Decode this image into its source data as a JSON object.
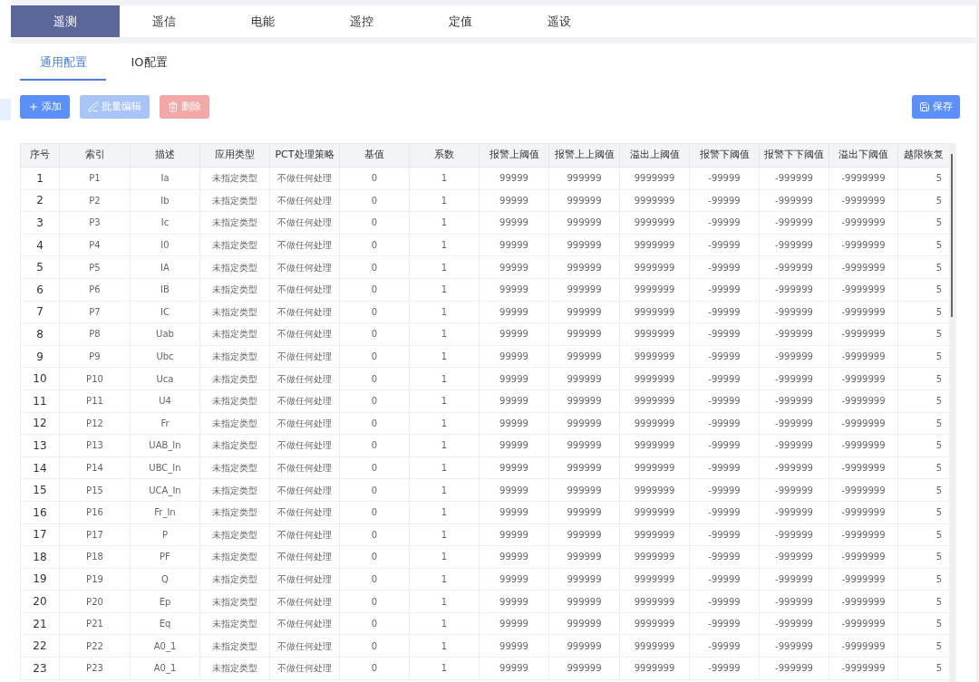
{
  "tabs": [
    {
      "label": "遥测",
      "selected": true
    },
    {
      "label": "遥信",
      "selected": false
    },
    {
      "label": "电能",
      "selected": false
    },
    {
      "label": "遥控",
      "selected": false
    },
    {
      "label": "定值",
      "selected": false
    },
    {
      "label": "遥设",
      "selected": false
    }
  ],
  "sub_tabs": [
    {
      "label": "通用配置",
      "selected": true
    },
    {
      "label": "IO配置",
      "selected": false
    }
  ],
  "toolbar": [
    {
      "kind": "add",
      "label": "添加",
      "disabled": false
    },
    {
      "kind": "edit",
      "label": "批量编辑",
      "disabled": true
    },
    {
      "kind": "delete",
      "label": "删除",
      "disabled": true
    }
  ],
  "save_button": {
    "label": "保存"
  },
  "table": {
    "columns": [
      "序号",
      "索引",
      "描述",
      "应用类型",
      "PCT处理策略",
      "基值",
      "系数",
      "报警上阈值",
      "报警上上阈值",
      "溢出上阈值",
      "报警下阈值",
      "报警下下阈值",
      "溢出下阈值",
      "越限恢复"
    ],
    "rows": [
      [
        "1",
        "P1",
        "Ia",
        "未指定类型",
        "不做任何处理",
        "0",
        "1",
        "99999",
        "999999",
        "9999999",
        "-99999",
        "-999999",
        "-9999999",
        "5"
      ],
      [
        "2",
        "P2",
        "Ib",
        "未指定类型",
        "不做任何处理",
        "0",
        "1",
        "99999",
        "999999",
        "9999999",
        "-99999",
        "-999999",
        "-9999999",
        "5"
      ],
      [
        "3",
        "P3",
        "Ic",
        "未指定类型",
        "不做任何处理",
        "0",
        "1",
        "99999",
        "999999",
        "9999999",
        "-99999",
        "-999999",
        "-9999999",
        "5"
      ],
      [
        "4",
        "P4",
        "I0",
        "未指定类型",
        "不做任何处理",
        "0",
        "1",
        "99999",
        "999999",
        "9999999",
        "-99999",
        "-999999",
        "-9999999",
        "5"
      ],
      [
        "5",
        "P5",
        "IA",
        "未指定类型",
        "不做任何处理",
        "0",
        "1",
        "99999",
        "999999",
        "9999999",
        "-99999",
        "-999999",
        "-9999999",
        "5"
      ],
      [
        "6",
        "P6",
        "IB",
        "未指定类型",
        "不做任何处理",
        "0",
        "1",
        "99999",
        "999999",
        "9999999",
        "-99999",
        "-999999",
        "-9999999",
        "5"
      ],
      [
        "7",
        "P7",
        "IC",
        "未指定类型",
        "不做任何处理",
        "0",
        "1",
        "99999",
        "999999",
        "9999999",
        "-99999",
        "-999999",
        "-9999999",
        "5"
      ],
      [
        "8",
        "P8",
        "Uab",
        "未指定类型",
        "不做任何处理",
        "0",
        "1",
        "99999",
        "999999",
        "9999999",
        "-99999",
        "-999999",
        "-9999999",
        "5"
      ],
      [
        "9",
        "P9",
        "Ubc",
        "未指定类型",
        "不做任何处理",
        "0",
        "1",
        "99999",
        "999999",
        "9999999",
        "-99999",
        "-999999",
        "-9999999",
        "5"
      ],
      [
        "10",
        "P10",
        "Uca",
        "未指定类型",
        "不做任何处理",
        "0",
        "1",
        "99999",
        "999999",
        "9999999",
        "-99999",
        "-999999",
        "-9999999",
        "5"
      ],
      [
        "11",
        "P11",
        "U4",
        "未指定类型",
        "不做任何处理",
        "0",
        "1",
        "99999",
        "999999",
        "9999999",
        "-99999",
        "-999999",
        "-9999999",
        "5"
      ],
      [
        "12",
        "P12",
        "Fr",
        "未指定类型",
        "不做任何处理",
        "0",
        "1",
        "99999",
        "999999",
        "9999999",
        "-99999",
        "-999999",
        "-9999999",
        "5"
      ],
      [
        "13",
        "P13",
        "UAB_In",
        "未指定类型",
        "不做任何处理",
        "0",
        "1",
        "99999",
        "999999",
        "9999999",
        "-99999",
        "-999999",
        "-9999999",
        "5"
      ],
      [
        "14",
        "P14",
        "UBC_In",
        "未指定类型",
        "不做任何处理",
        "0",
        "1",
        "99999",
        "999999",
        "9999999",
        "-99999",
        "-999999",
        "-9999999",
        "5"
      ],
      [
        "15",
        "P15",
        "UCA_In",
        "未指定类型",
        "不做任何处理",
        "0",
        "1",
        "99999",
        "999999",
        "9999999",
        "-99999",
        "-999999",
        "-9999999",
        "5"
      ],
      [
        "16",
        "P16",
        "Fr_In",
        "未指定类型",
        "不做任何处理",
        "0",
        "1",
        "99999",
        "999999",
        "9999999",
        "-99999",
        "-999999",
        "-9999999",
        "5"
      ],
      [
        "17",
        "P17",
        "P",
        "未指定类型",
        "不做任何处理",
        "0",
        "1",
        "99999",
        "999999",
        "9999999",
        "-99999",
        "-999999",
        "-9999999",
        "5"
      ],
      [
        "18",
        "P18",
        "PF",
        "未指定类型",
        "不做任何处理",
        "0",
        "1",
        "99999",
        "999999",
        "9999999",
        "-99999",
        "-999999",
        "-9999999",
        "5"
      ],
      [
        "19",
        "P19",
        "Q",
        "未指定类型",
        "不做任何处理",
        "0",
        "1",
        "99999",
        "999999",
        "9999999",
        "-99999",
        "-999999",
        "-9999999",
        "5"
      ],
      [
        "20",
        "P20",
        "Ep",
        "未指定类型",
        "不做任何处理",
        "0",
        "1",
        "99999",
        "999999",
        "9999999",
        "-99999",
        "-999999",
        "-9999999",
        "5"
      ],
      [
        "21",
        "P21",
        "Eq",
        "未指定类型",
        "不做任何处理",
        "0",
        "1",
        "99999",
        "999999",
        "9999999",
        "-99999",
        "-999999",
        "-9999999",
        "5"
      ],
      [
        "22",
        "P22",
        "A0_1",
        "未指定类型",
        "不做任何处理",
        "0",
        "1",
        "99999",
        "999999",
        "9999999",
        "-99999",
        "-999999",
        "-9999999",
        "5"
      ],
      [
        "23",
        "P23",
        "A0_1",
        "未指定类型",
        "不做任何处理",
        "0",
        "1",
        "99999",
        "999999",
        "9999999",
        "-99999",
        "-999999",
        "-9999999",
        "5"
      ]
    ]
  }
}
